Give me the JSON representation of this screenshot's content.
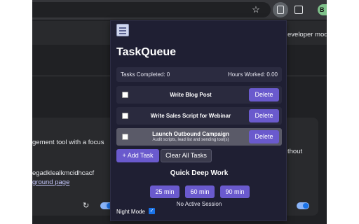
{
  "browser": {
    "avatar_letter": "B",
    "bg_texts": {
      "developer_mode": "eveloper mode",
      "description": "gement tool with a focus",
      "without": "thout",
      "extension_id": "egadklealkmcidhcacf",
      "background_page": "ground page"
    }
  },
  "popup": {
    "title": "TaskQueue",
    "stats": {
      "tasks_completed_label": "Tasks Completed: 0",
      "hours_worked_label": "Hours Worked: 0.00"
    },
    "tasks": [
      {
        "title": "Write Blog Post",
        "subtitle": "",
        "checked": false,
        "delete_label": "Delete"
      },
      {
        "title": "Write Sales Script for Webinar",
        "subtitle": "",
        "checked": false,
        "delete_label": "Delete"
      },
      {
        "title": "Launch Outbound Campaign",
        "subtitle": "Audit scripts, lead list and sending tool(s)",
        "checked": false,
        "delete_label": "Delete"
      }
    ],
    "add_task_label": "+ Add Task",
    "clear_all_label": "Clear All Tasks",
    "deep_work_title": "Quick Deep Work",
    "deep_work_options": [
      "25 min",
      "60 min",
      "90 min"
    ],
    "session_status": "No Active Session",
    "night_mode_label": "Night Mode",
    "night_mode_checked": true
  },
  "colors": {
    "accent": "#6a5acd",
    "popup_bg": "#1f1f33"
  }
}
